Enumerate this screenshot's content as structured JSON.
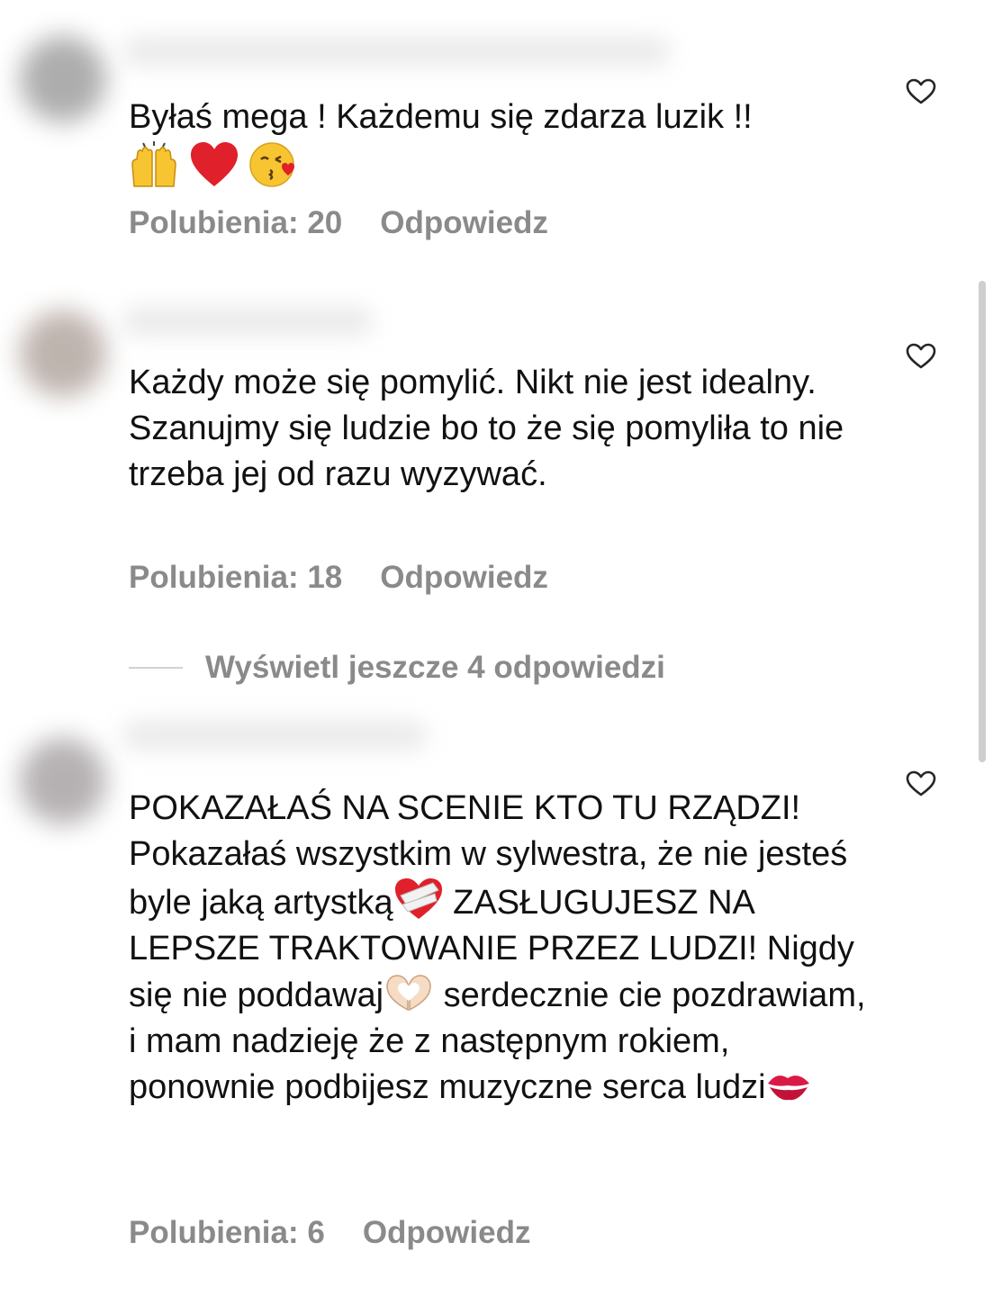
{
  "comments": [
    {
      "text": "Byłaś mega ! Każdemu się zdarza luzik !!",
      "emoji_line": [
        "raising-hands-emoji",
        "red-heart-emoji",
        "face-blowing-kiss-emoji"
      ],
      "likes_label": "Polubienia: 20",
      "reply_label": "Odpowiedz"
    },
    {
      "text": "Każdy może się pomylić. Nikt nie jest idealny. Szanujmy się ludzie bo to że się pomyliła to nie trzeba jej od razu wyzywać.",
      "likes_label": "Polubienia: 18",
      "reply_label": "Odpowiedz"
    },
    {
      "text_parts": [
        "POKAZAŁAŚ NA SCENIE KTO TU RZĄDZI! Pokazałaś wszystkim w sylwestra, że nie jesteś byle jaką artystką",
        " ZASŁUGUJESZ NA LEPSZE TRAKTOWANIE PRZEZ LUDZI! Nigdy się nie poddawaj",
        "  serdecznie cie pozdrawiam, i mam nadzieję że z następnym rokiem, ponownie podbijesz muzyczne serca ludzi"
      ],
      "inline_emojis": [
        "mending-heart-emoji",
        "heart-hands-emoji",
        "kiss-mark-emoji"
      ],
      "likes_label": "Polubienia: 6",
      "reply_label": "Odpowiedz"
    }
  ],
  "view_replies_label": "Wyświetl jeszcze 4 odpowiedzi",
  "colors": {
    "text": "#111111",
    "meta": "#8a8a8a",
    "heart_outline": "#262626",
    "red": "#e0202a",
    "yellow": "#f7c531"
  }
}
